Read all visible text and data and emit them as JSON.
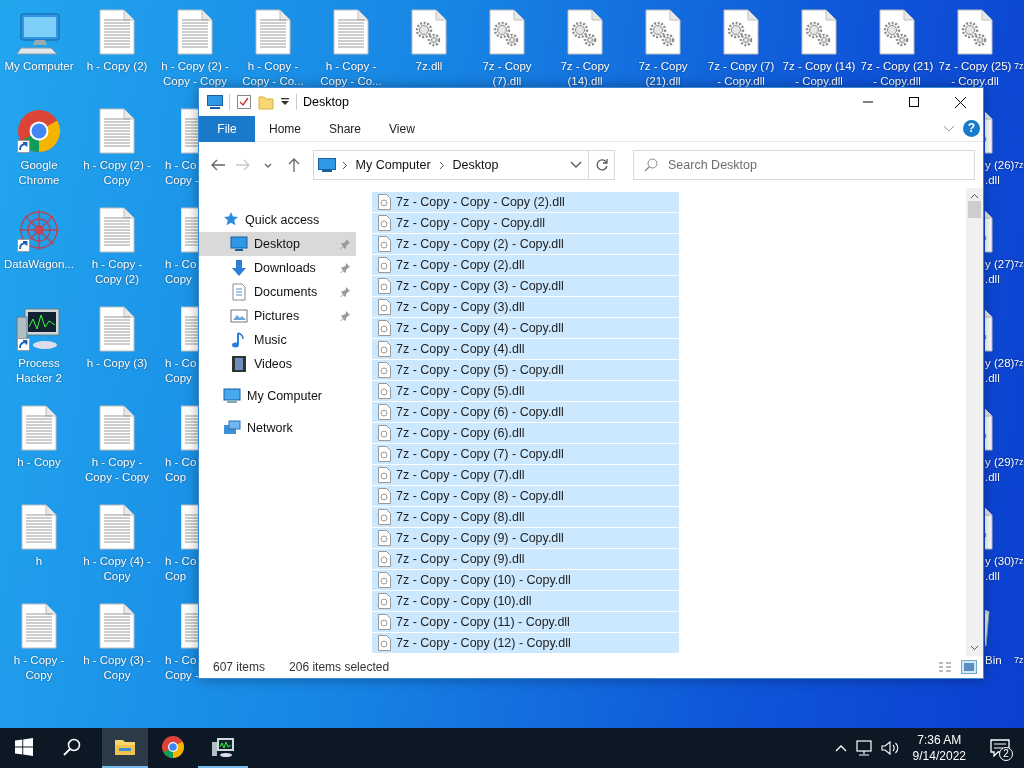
{
  "desktop": {
    "columns": [
      {
        "items": [
          {
            "kind": "computer",
            "label": "My Computer",
            "shortcut": false
          },
          {
            "kind": "chrome",
            "label": "Google\nChrome",
            "shortcut": true
          },
          {
            "kind": "datawagon",
            "label": "DataWagon...",
            "shortcut": true
          },
          {
            "kind": "processhacker",
            "label": "Process\nHacker 2",
            "shortcut": true
          },
          {
            "kind": "doc",
            "label": "h - Copy",
            "shortcut": false
          },
          {
            "kind": "doc",
            "label": "h",
            "shortcut": false
          },
          {
            "kind": "doc",
            "label": "h - Copy -\nCopy",
            "shortcut": false
          }
        ]
      },
      {
        "items": [
          {
            "kind": "doc",
            "label": "h - Copy (2)",
            "shortcut": false
          },
          {
            "kind": "doc",
            "label": "h - Copy (2) -\nCopy",
            "shortcut": false
          },
          {
            "kind": "doc",
            "label": "h - Copy -\nCopy (2)",
            "shortcut": false
          },
          {
            "kind": "doc",
            "label": "h - Copy (3)",
            "shortcut": false
          },
          {
            "kind": "doc",
            "label": "h - Copy -\nCopy - Copy",
            "shortcut": false
          },
          {
            "kind": "doc",
            "label": "h - Copy (4) -\nCopy",
            "shortcut": false
          },
          {
            "kind": "doc",
            "label": "h - Copy (3) -\nCopy",
            "shortcut": false
          }
        ]
      },
      {
        "items": [
          {
            "kind": "doc",
            "label": "h - Copy (2) -\nCopy - Copy",
            "shortcut": false
          },
          {
            "kind": "doc",
            "label": "h - Co\nCopy -",
            "shortcut": false,
            "partly_covered": true
          },
          {
            "kind": "doc",
            "label": "h - Co\nCopy",
            "shortcut": false,
            "partly_covered": true
          },
          {
            "kind": "doc",
            "label": "h - Co\nCopy",
            "shortcut": false,
            "partly_covered": true
          },
          {
            "kind": "doc",
            "label": "h - Co\nCop",
            "shortcut": false,
            "partly_covered": true
          },
          {
            "kind": "doc",
            "label": "h - Co\nCop",
            "shortcut": false,
            "partly_covered": true
          },
          {
            "kind": "doc",
            "label": "h - Co\nCopy -",
            "shortcut": false,
            "partly_covered": true
          }
        ]
      },
      {
        "items": [
          {
            "kind": "doc",
            "label": "h - Copy -\nCopy - Co...",
            "shortcut": false
          }
        ]
      },
      {
        "items": [
          {
            "kind": "doc",
            "label": "h - Copy -\nCopy - Co...",
            "shortcut": false
          }
        ]
      },
      {
        "items": [
          {
            "kind": "dll",
            "label": "7z.dll",
            "shortcut": false
          }
        ]
      },
      {
        "items": [
          {
            "kind": "dll",
            "label": "7z - Copy\n(7).dll",
            "shortcut": false
          }
        ]
      },
      {
        "items": [
          {
            "kind": "dll",
            "label": "7z - Copy\n(14).dll",
            "shortcut": false
          }
        ]
      },
      {
        "items": [
          {
            "kind": "dll",
            "label": "7z - Copy\n(21).dll",
            "shortcut": false
          }
        ]
      },
      {
        "items": [
          {
            "kind": "dll",
            "label": "7z - Copy (7)\n- Copy.dll",
            "shortcut": false
          }
        ]
      },
      {
        "items": [
          {
            "kind": "dll",
            "label": "7z - Copy (14)\n- Copy.dll",
            "shortcut": false
          }
        ]
      },
      {
        "items": [
          {
            "kind": "dll",
            "label": "7z - Copy (21)\n- Copy.dll",
            "shortcut": false
          }
        ]
      },
      {
        "items": [
          {
            "kind": "dll",
            "label": "7z - Copy (25)\n- Copy.dll",
            "shortcut": false
          },
          {
            "kind": "dll",
            "label": "y (26)\n.dll",
            "shortcut": false,
            "partly_covered": true
          },
          {
            "kind": "dll",
            "label": "y (27)\n.dll",
            "shortcut": false,
            "partly_covered": true
          },
          {
            "kind": "dll",
            "label": "y (28)\n.dll",
            "shortcut": false,
            "partly_covered": true
          },
          {
            "kind": "dll",
            "label": "y (29)\n.dll",
            "shortcut": false,
            "partly_covered": true
          },
          {
            "kind": "dll",
            "label": "y (30)\n.dll",
            "shortcut": false,
            "partly_covered": true
          },
          {
            "kind": "recycle",
            "label": "Bin",
            "shortcut": false,
            "partly_covered": true
          }
        ]
      },
      {
        "items": [
          {
            "kind": "none",
            "label": "7z",
            "shortcut": false
          },
          {
            "kind": "none",
            "label": "7z",
            "shortcut": false
          },
          {
            "kind": "none",
            "label": "7z",
            "shortcut": false
          },
          {
            "kind": "none",
            "label": "7z",
            "shortcut": false
          },
          {
            "kind": "none",
            "label": "7z",
            "shortcut": false
          },
          {
            "kind": "none",
            "label": "7z",
            "shortcut": false
          },
          {
            "kind": "none",
            "label": "7z",
            "shortcut": false
          }
        ]
      }
    ]
  },
  "explorer": {
    "title": "Desktop",
    "ribbon_tabs": [
      {
        "kind": "menu",
        "label": "File"
      },
      {
        "kind": "tab",
        "label": "Home"
      },
      {
        "kind": "tab",
        "label": "Share"
      },
      {
        "kind": "tab",
        "label": "View"
      }
    ],
    "help": "?",
    "nav_buttons": [
      {
        "kind": "back",
        "disabled": false
      },
      {
        "kind": "forward",
        "disabled": true
      },
      {
        "kind": "recent",
        "disabled": false
      },
      {
        "kind": "up",
        "disabled": false
      }
    ],
    "address": [
      "My Computer",
      "Desktop"
    ],
    "search": {
      "placeholder": "Search Desktop"
    },
    "nav": [
      {
        "kind": "star",
        "label": "Quick access",
        "selected": false,
        "children": [
          {
            "kind": "desktop",
            "label": "Desktop",
            "selected": true,
            "pinned": true
          },
          {
            "kind": "downloads",
            "label": "Downloads",
            "selected": false,
            "pinned": true
          },
          {
            "kind": "documents",
            "label": "Documents",
            "selected": false,
            "pinned": true
          },
          {
            "kind": "pictures",
            "label": "Pictures",
            "selected": false,
            "pinned": true
          },
          {
            "kind": "music",
            "label": "Music",
            "selected": false,
            "pinned": false
          },
          {
            "kind": "videos",
            "label": "Videos",
            "selected": false,
            "pinned": false
          }
        ]
      },
      {
        "kind": "computer",
        "label": "My Computer",
        "selected": false
      },
      {
        "kind": "network",
        "label": "Network",
        "selected": false
      }
    ],
    "files": [
      {
        "name": "7z - Copy - Copy - Copy (2).dll",
        "selected": true
      },
      {
        "name": "7z - Copy - Copy - Copy.dll",
        "selected": true
      },
      {
        "name": "7z - Copy - Copy (2) - Copy.dll",
        "selected": true
      },
      {
        "name": "7z - Copy - Copy (2).dll",
        "selected": true
      },
      {
        "name": "7z - Copy - Copy (3) - Copy.dll",
        "selected": true
      },
      {
        "name": "7z - Copy - Copy (3).dll",
        "selected": true
      },
      {
        "name": "7z - Copy - Copy (4) - Copy.dll",
        "selected": true
      },
      {
        "name": "7z - Copy - Copy (4).dll",
        "selected": true
      },
      {
        "name": "7z - Copy - Copy (5) - Copy.dll",
        "selected": true
      },
      {
        "name": "7z - Copy - Copy (5).dll",
        "selected": true
      },
      {
        "name": "7z - Copy - Copy (6) - Copy.dll",
        "selected": true
      },
      {
        "name": "7z - Copy - Copy (6).dll",
        "selected": true
      },
      {
        "name": "7z - Copy - Copy (7) - Copy.dll",
        "selected": true
      },
      {
        "name": "7z - Copy - Copy (7).dll",
        "selected": true
      },
      {
        "name": "7z - Copy - Copy (8) - Copy.dll",
        "selected": true
      },
      {
        "name": "7z - Copy - Copy (8).dll",
        "selected": true
      },
      {
        "name": "7z - Copy - Copy (9) - Copy.dll",
        "selected": true
      },
      {
        "name": "7z - Copy - Copy (9).dll",
        "selected": true
      },
      {
        "name": "7z - Copy - Copy (10) - Copy.dll",
        "selected": true
      },
      {
        "name": "7z - Copy - Copy (10).dll",
        "selected": true
      },
      {
        "name": "7z - Copy - Copy (11) - Copy.dll",
        "selected": true
      },
      {
        "name": "7z - Copy - Copy (12) - Copy.dll",
        "selected": true
      }
    ],
    "status": {
      "count": "607 items",
      "selection": "206 items selected"
    }
  },
  "taskbar": {
    "apps": [
      {
        "kind": "explorer",
        "active": true,
        "running": true
      },
      {
        "kind": "chrome",
        "active": false,
        "running": false
      },
      {
        "kind": "processhacker",
        "active": false,
        "running": true
      }
    ],
    "time": "7:36 AM",
    "date": "9/14/2022",
    "notifications": "2"
  }
}
